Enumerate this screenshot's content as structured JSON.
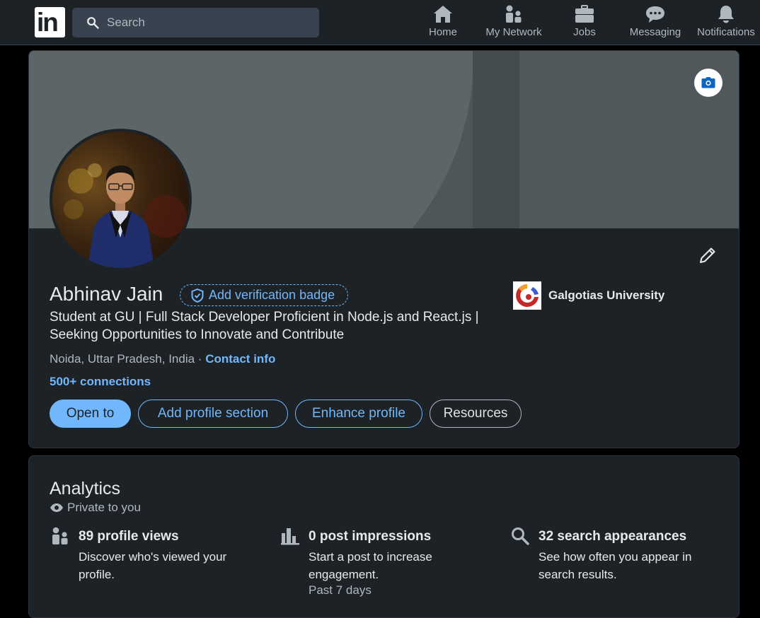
{
  "nav": {
    "logo": "in",
    "search_placeholder": "Search",
    "items": [
      {
        "label": "Home",
        "icon": "home-icon"
      },
      {
        "label": "My Network",
        "icon": "people-icon"
      },
      {
        "label": "Jobs",
        "icon": "briefcase-icon"
      },
      {
        "label": "Messaging",
        "icon": "chat-icon"
      },
      {
        "label": "Notifications",
        "icon": "bell-icon"
      }
    ]
  },
  "profile": {
    "name": "Abhinav Jain",
    "verify_label": "Add verification badge",
    "headline": "Student at GU | Full Stack Developer Proficient in Node.js and React.js | Seeking Opportunities to Innovate and Contribute",
    "location": "Noida, Uttar Pradesh, India ·",
    "contact_label": "Contact info",
    "connections": "500+ connections",
    "university": "Galgotias University",
    "buttons": {
      "open_to": "Open to",
      "add_section": "Add profile section",
      "enhance": "Enhance profile",
      "resources": "Resources"
    }
  },
  "analytics": {
    "title": "Analytics",
    "privacy": "Private to you",
    "stats": [
      {
        "title": "89 profile views",
        "desc": "Discover who's viewed your profile.",
        "icon": "people-icon"
      },
      {
        "title": "0 post impressions",
        "desc": "Start a post to increase engagement.",
        "period": "Past 7 days",
        "icon": "bar-chart-icon"
      },
      {
        "title": "32 search appearances",
        "desc": "See how often you appear in search results.",
        "icon": "search-icon"
      }
    ]
  },
  "colors": {
    "accent": "#71b7fb",
    "card_bg": "#1d2226",
    "page_bg": "#000000"
  }
}
